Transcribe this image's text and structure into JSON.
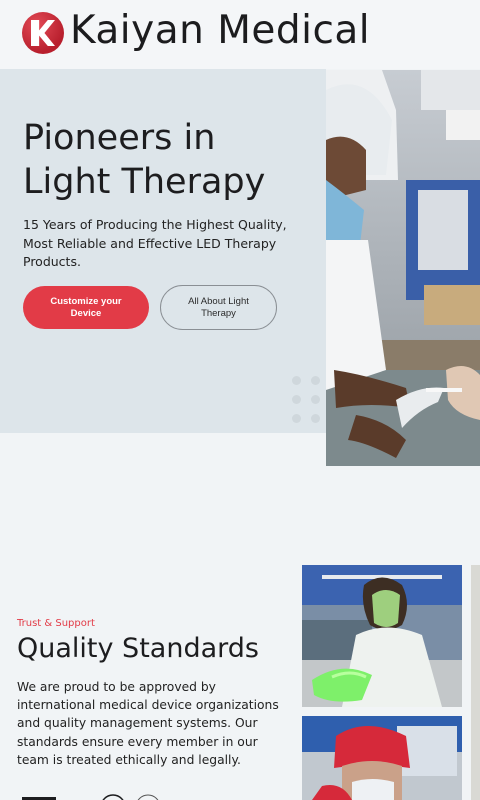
{
  "brand": {
    "name": "Kaiyan Medical",
    "logo": "kaiyan-k-logo",
    "color": "#e23b47"
  },
  "hero": {
    "title": "Pioneers in Light Therapy",
    "subtitle": "15 Years of Producing the Highest Quality, Most Reliable and Effective LED Therapy Products.",
    "primary_button": "Customize your Device",
    "secondary_button": "All About Light Therapy"
  },
  "quality": {
    "eyebrow": "Trust & Support",
    "title": "Quality Standards",
    "text": "We are proud to be approved by international medical device organizations and quality management systems. Our standards ensure every member in our team is treated ethically and legally."
  },
  "icons": [
    "kaiyan-k-logo",
    "decorative-dots-icon",
    "certification-logo"
  ]
}
